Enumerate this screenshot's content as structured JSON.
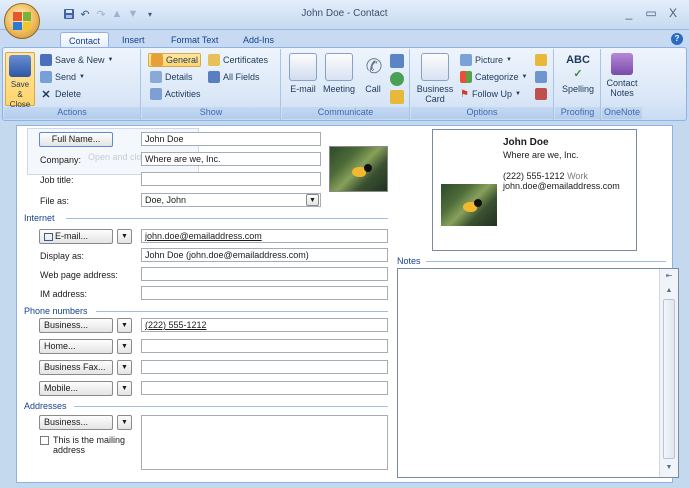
{
  "window": {
    "title": "John Doe - Contact",
    "minimize": "_",
    "maximize": "▭",
    "close": "X"
  },
  "tabs": [
    "Contact",
    "Insert",
    "Format Text",
    "Add-Ins"
  ],
  "ribbon": {
    "actions": {
      "save_close": "Save & Close",
      "save_new": "Save & New",
      "send": "Send",
      "delete": "Delete",
      "label": "Actions"
    },
    "show": {
      "general": "General",
      "details": "Details",
      "activities": "Activities",
      "certificates": "Certificates",
      "all_fields": "All Fields",
      "label": "Show"
    },
    "communicate": {
      "email": "E-mail",
      "meeting": "Meeting",
      "call": "Call",
      "label": "Communicate"
    },
    "options": {
      "business_card": "Business Card",
      "picture": "Picture",
      "categorize": "Categorize",
      "follow_up": "Follow Up",
      "label": "Options"
    },
    "proofing": {
      "spelling": "Spelling",
      "label": "Proofing"
    },
    "onenote": {
      "contact_notes": "Contact Notes",
      "label": "OneNote"
    }
  },
  "form": {
    "full_name_btn": "Full Name...",
    "full_name": "John Doe",
    "company_label": "Company:",
    "company": "Where are we, Inc.",
    "job_title_label": "Job title:",
    "job_title": "",
    "file_as_label": "File as:",
    "file_as": "Doe, John",
    "internet_section": "Internet",
    "email_btn": "E-mail...",
    "email": "john.doe@emailaddress.com",
    "display_as_label": "Display as:",
    "display_as": "John Doe (john.doe@emailaddress.com)",
    "web_label": "Web page address:",
    "web": "",
    "im_label": "IM address:",
    "im": "",
    "phone_section": "Phone numbers",
    "business_btn": "Business...",
    "business_phone": "(222) 555-1212",
    "home_btn": "Home...",
    "home_phone": "",
    "fax_btn": "Business Fax...",
    "fax": "",
    "mobile_btn": "Mobile...",
    "mobile": "",
    "addresses_section": "Addresses",
    "address_btn": "Business...",
    "mailing_label": "This is the mailing address",
    "notes_section": "Notes",
    "ghost_text": "Open and close"
  },
  "card": {
    "name": "John Doe",
    "company": "Where are we, Inc.",
    "phone": "(222) 555-1212",
    "phone_type": "Work",
    "email": "john.doe@emailaddress.com"
  }
}
